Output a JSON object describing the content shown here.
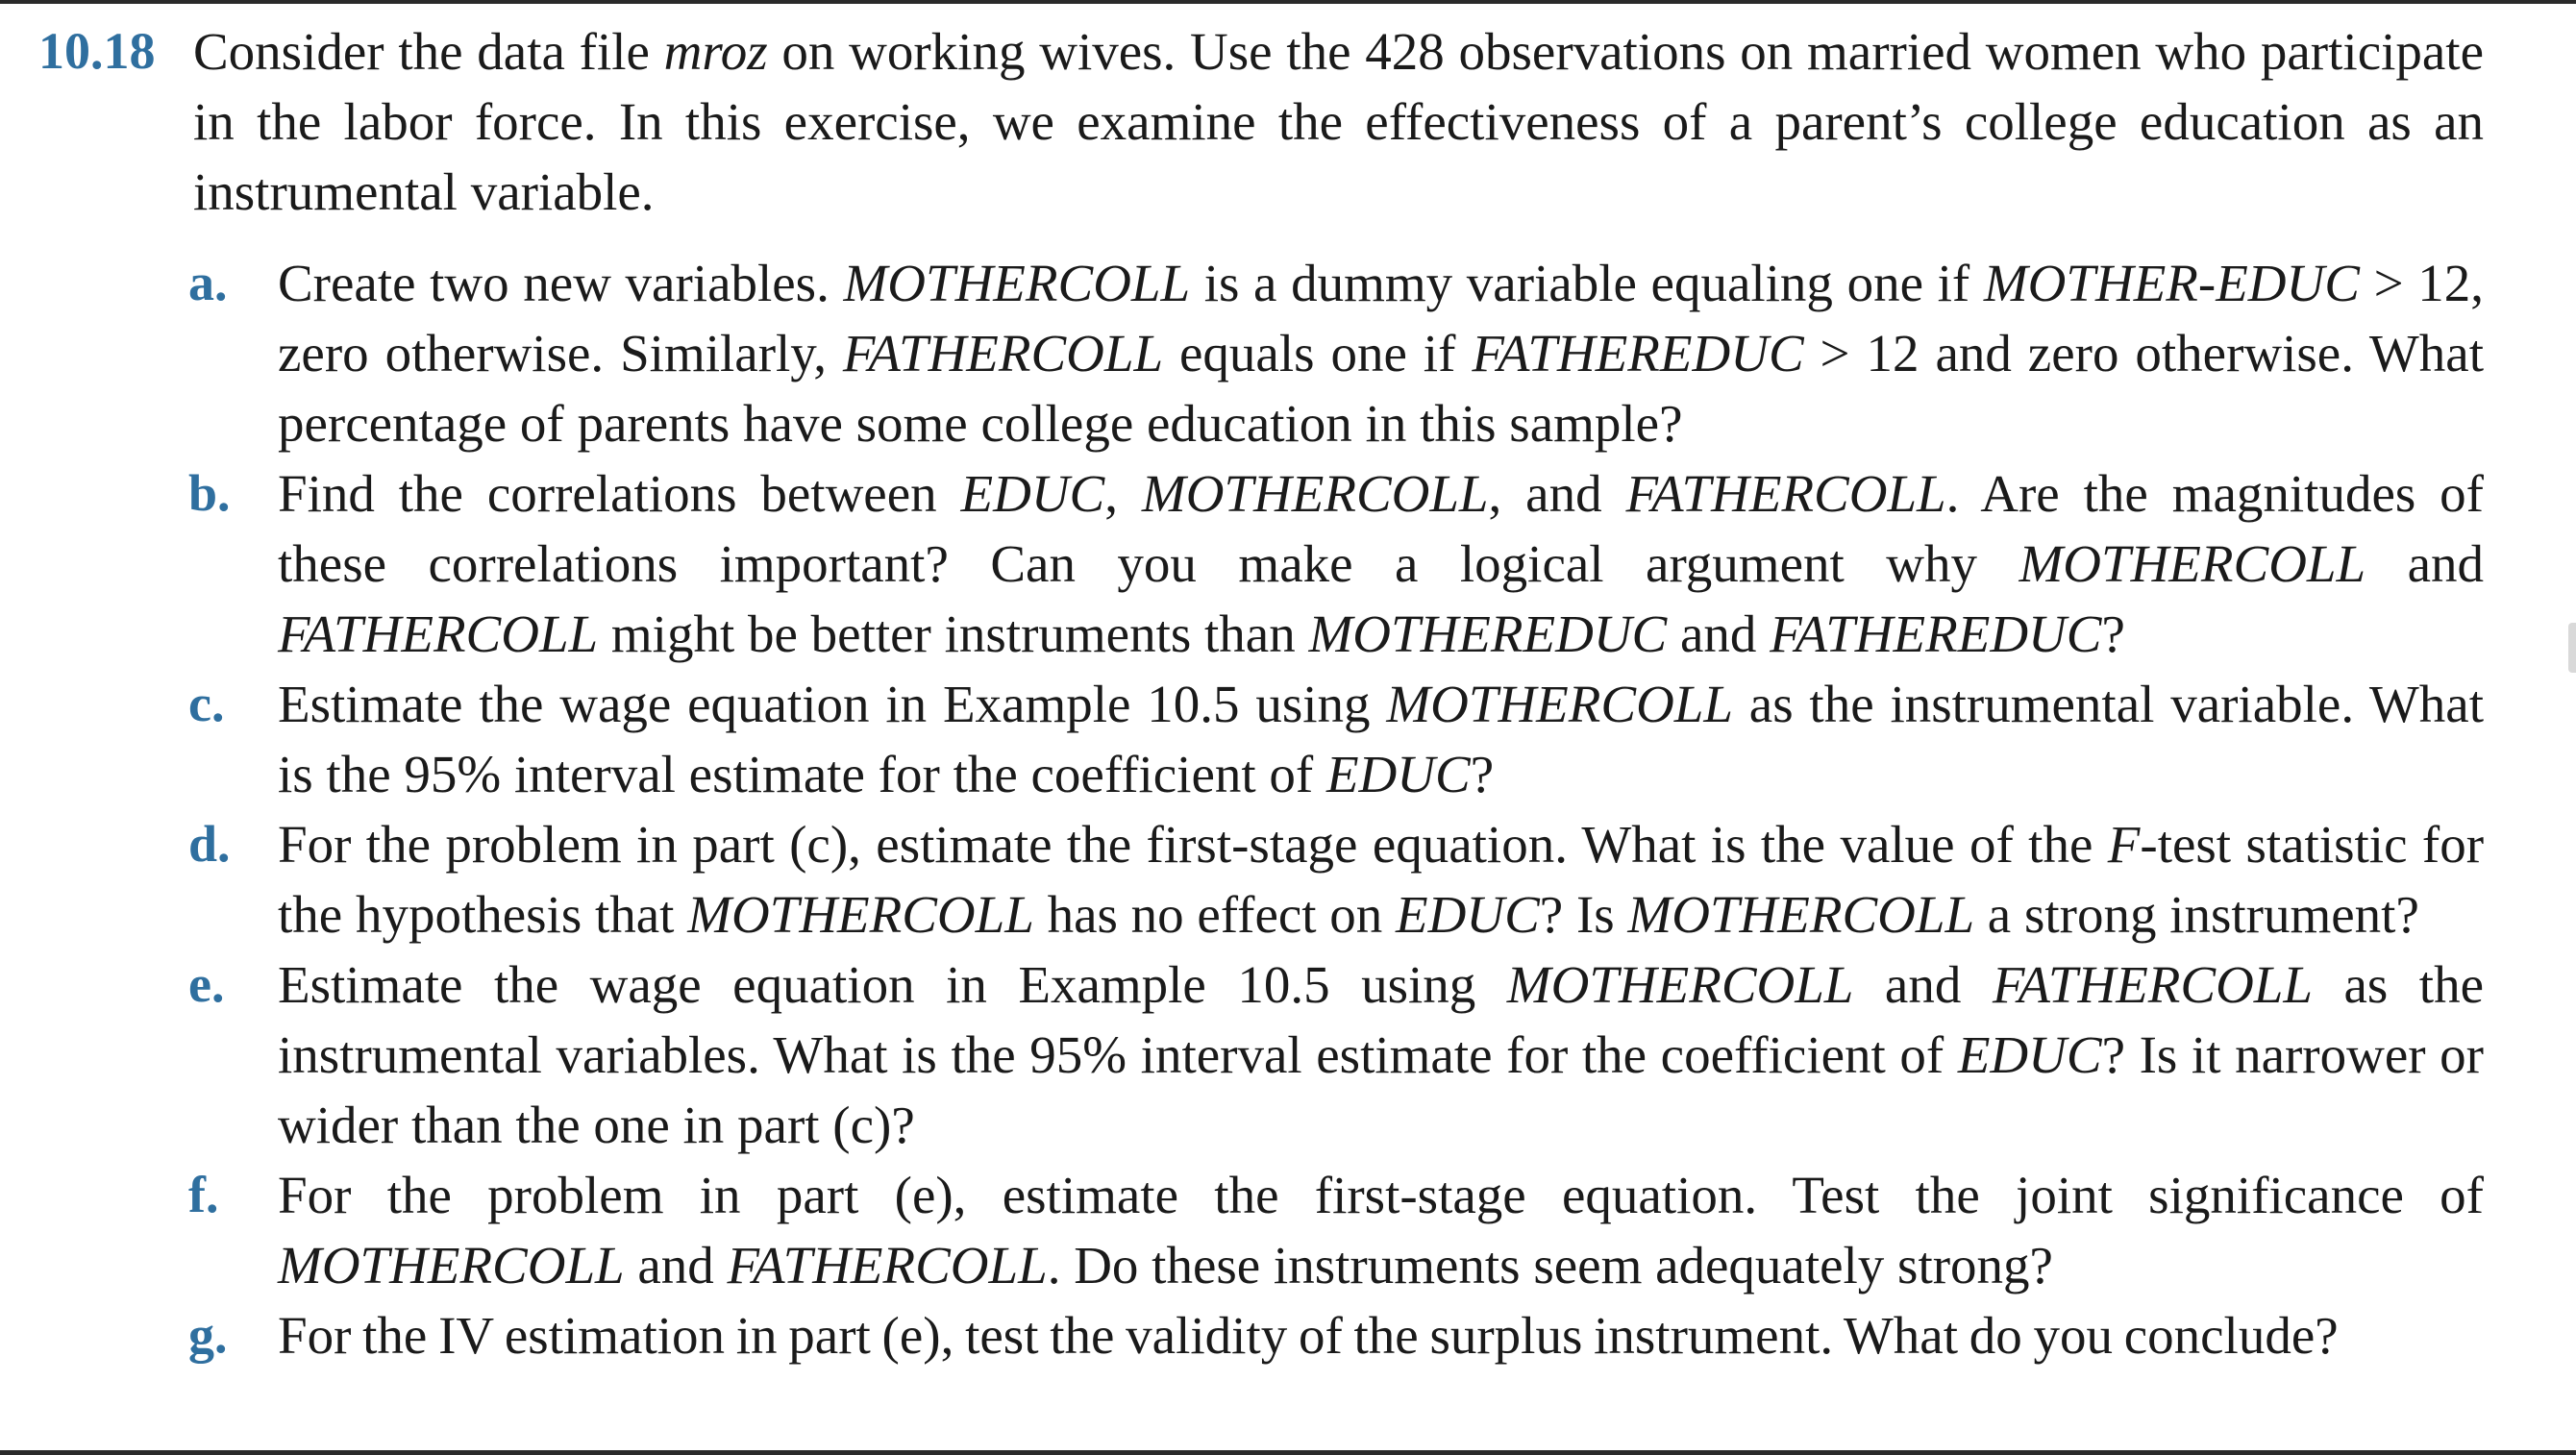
{
  "problem": {
    "number": "10.18",
    "intro": "Consider the data file mroz on working wives. Use the 428 observations on married women who participate in the labor force. In this exercise, we examine the effectiveness of a parent’s college education as an instrumental variable.",
    "parts": [
      {
        "letter": "a.",
        "text": "Create two new variables. MOTHERCOLL is a dummy variable equaling one if MOTHER-EDUC > 12, zero otherwise. Similarly, FATHERCOLL equals one if FATHEREDUC > 12 and zero otherwise. What percentage of parents have some college education in this sample?"
      },
      {
        "letter": "b.",
        "text": "Find the correlations between EDUC, MOTHERCOLL, and FATHERCOLL. Are the magnitudes of these correlations important? Can you make a logical argument why MOTHERCOLL and FATHERCOLL might be better instruments than MOTHEREDUC and FATHEREDUC?"
      },
      {
        "letter": "c.",
        "text": "Estimate the wage equation in Example 10.5 using MOTHERCOLL as the instrumental variable. What is the 95% interval estimate for the coefficient of EDUC?"
      },
      {
        "letter": "d.",
        "text": "For the problem in part (c), estimate the first-stage equation. What is the value of the F-test statistic for the hypothesis that MOTHERCOLL has no effect on EDUC? Is MOTHERCOLL a strong instrument?"
      },
      {
        "letter": "e.",
        "text": "Estimate the wage equation in Example 10.5 using MOTHERCOLL and FATHERCOLL as the instrumental variables. What is the 95% interval estimate for the coefficient of EDUC? Is it narrower or wider than the one in part (c)?"
      },
      {
        "letter": "f.",
        "text": "For the problem in part (e), estimate the first-stage equation. Test the joint significance of MOTHERCOLL and FATHERCOLL. Do these instruments seem adequately strong?"
      },
      {
        "letter": "g.",
        "text": "For the IV estimation in part (e), test the validity of the surplus instrument. What do you conclude?"
      }
    ]
  }
}
